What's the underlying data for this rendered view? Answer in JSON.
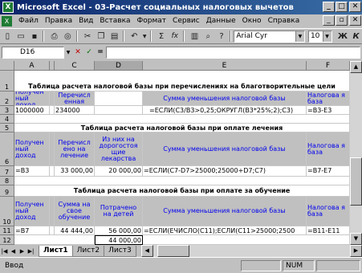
{
  "window": {
    "title": "Microsoft Excel - 03-Расчет социальных налоговых вычетов"
  },
  "menu": [
    "Файл",
    "Правка",
    "Вид",
    "Вставка",
    "Формат",
    "Сервис",
    "Данные",
    "Окно",
    "Справка"
  ],
  "toolbar": {
    "font_name": "Arial Cyr",
    "font_size": "10",
    "sigma": "Σ",
    "fx": "fx",
    "bold": "Ж",
    "italic": "К"
  },
  "formula_bar": {
    "name_box": "D16",
    "cancel": "✕",
    "enter": "✓",
    "eq": "=",
    "content": ""
  },
  "columns": [
    "A",
    "B",
    "C",
    "D",
    "E",
    "F"
  ],
  "rows": {
    "r1": {
      "num": "1",
      "title": "Таблица расчета налоговой базы при перечислениях на благотворительные цели"
    },
    "r2": {
      "num": "2",
      "a": "Получен ный доход",
      "c": "Перечисл енная",
      "e": "Сумма уменьшения налоговой базы",
      "f": "Налогова я база"
    },
    "r3": {
      "num": "3",
      "a": "1000000",
      "c": "234000",
      "e": "=ЕСЛИ(C3/B3>0,25;ОКРУГЛ(B3*25%;2);C3)",
      "f": "=B3-E3"
    },
    "r4": {
      "num": "4"
    },
    "r5": {
      "num": "5",
      "title": "Таблица расчета налоговой базы при оплате лечения"
    },
    "r6": {
      "num": "6",
      "a": "Получен ный доход",
      "c": "Перечисл ено на лечение",
      "d": "Из них на дорогостоя щие лекарства",
      "e": "Сумма уменьшения налоговой базы",
      "f": "Налогова я база"
    },
    "r7": {
      "num": "7",
      "a": "=B3",
      "c": "33 000,00",
      "d": "20 000,00",
      "e": "=ЕСЛИ(C7-D7>25000;25000+D7;C7)",
      "f": "=B7-E7"
    },
    "r8": {
      "num": "8"
    },
    "r9": {
      "num": "9",
      "title": "Таблица расчета налоговой базы при оплате за обучение"
    },
    "r10": {
      "num": "10",
      "a": "Получен ный доход",
      "c": "Сумма на свое обучение",
      "d": "Потрачено на детей",
      "e": "Сумма уменьшения налоговой базы",
      "f": "Налогова я база"
    },
    "r11": {
      "num": "11",
      "a": "=B7",
      "c": "44 444,00",
      "d": "56 000,00",
      "e": "=ЕСЛИ(ЕЧИСЛО(C11);ЕСЛИ(C11>25000;2500",
      "f": "=B11-E11"
    },
    "r12": {
      "num": "12",
      "d": "44 000,00"
    }
  },
  "sheets": [
    "Лист1",
    "Лист2",
    "Лист3"
  ],
  "active_sheet": "Лист1",
  "status": {
    "mode": "Ввод",
    "num": "NUM"
  }
}
